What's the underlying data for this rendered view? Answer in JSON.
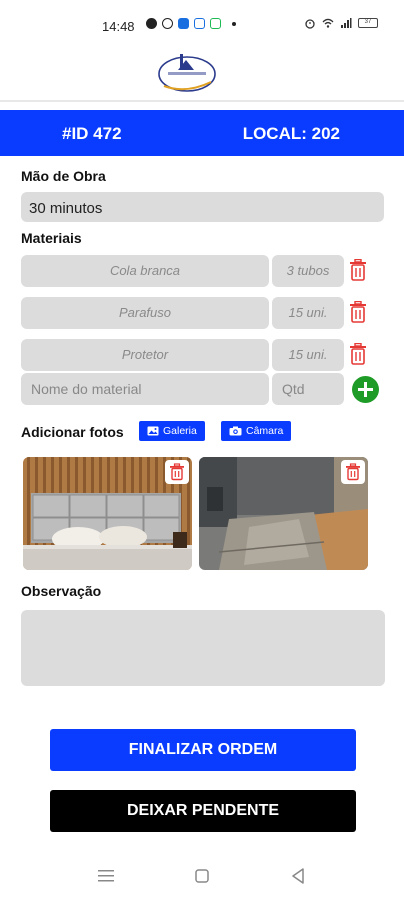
{
  "status_bar": {
    "time": "14:48",
    "battery": "37"
  },
  "header": {
    "id_label": "#ID 472",
    "local_label": "LOCAL: 202"
  },
  "labor": {
    "label": "Mão de Obra",
    "value": "30 minutos"
  },
  "materials": {
    "label": "Materiais",
    "items": [
      {
        "name": "Cola branca",
        "qty": "3 tubos"
      },
      {
        "name": "Parafuso",
        "qty": "15 uni."
      },
      {
        "name": "Protetor",
        "qty": "15 uni."
      }
    ],
    "name_placeholder": "Nome do material",
    "qty_placeholder": "Qtd"
  },
  "photos": {
    "label": "Adicionar fotos",
    "gallery_label": "Galeria",
    "camera_label": "Câmara"
  },
  "observation": {
    "label": "Observação"
  },
  "actions": {
    "finish_label": "FINALIZAR ORDEM",
    "pending_label": "DEIXAR PENDENTE"
  },
  "colors": {
    "primary": "#0a3cff",
    "add": "#1f9c27",
    "delete": "#e53935",
    "field": "#dcdcdc"
  }
}
